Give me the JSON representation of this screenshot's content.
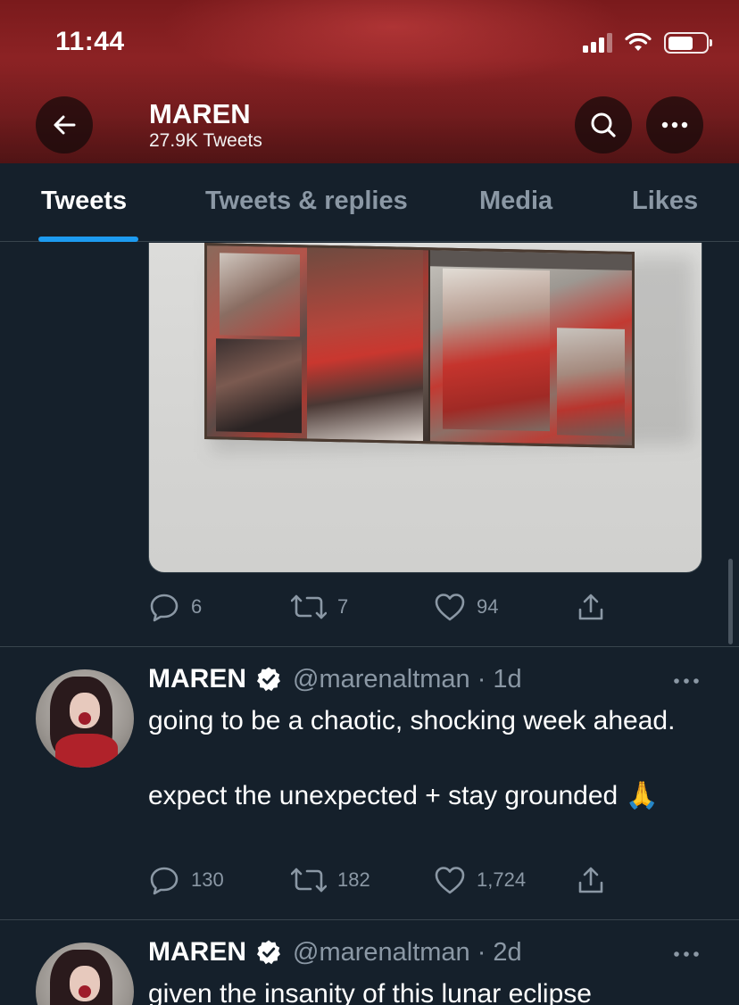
{
  "status_bar": {
    "time": "11:44"
  },
  "header": {
    "name": "MAREN",
    "tweet_count": "27.9K Tweets"
  },
  "tabs": [
    {
      "label": "Tweets",
      "active": true
    },
    {
      "label": "Tweets & replies",
      "active": false
    },
    {
      "label": "Media",
      "active": false
    },
    {
      "label": "Likes",
      "active": false
    }
  ],
  "colors": {
    "background": "#15202b",
    "accent": "#1d9bf0",
    "muted": "#8b98a5",
    "divider": "#38444d",
    "header": "#7b1e20"
  },
  "tweet_1": {
    "media": "magazine spread photo",
    "stats": {
      "replies": "6",
      "retweets": "7",
      "likes": "94"
    }
  },
  "tweet_2": {
    "name": "MAREN",
    "handle": "@marenaltman",
    "sep": "·",
    "time": "1d",
    "text": "going to be a chaotic, shocking week ahead.\n\nexpect the unexpected + stay grounded 🙏",
    "stats": {
      "replies": "130",
      "retweets": "182",
      "likes": "1,724"
    }
  },
  "tweet_3": {
    "name": "MAREN",
    "handle": "@marenaltman",
    "sep": "·",
    "time": "2d",
    "text": "given the insanity of this lunar eclipse"
  },
  "icons": [
    "back-arrow-icon",
    "search-icon",
    "more-icon",
    "reply-icon",
    "retweet-icon",
    "like-icon",
    "share-icon",
    "verified-icon",
    "signal-icon",
    "wifi-icon",
    "battery-icon"
  ]
}
